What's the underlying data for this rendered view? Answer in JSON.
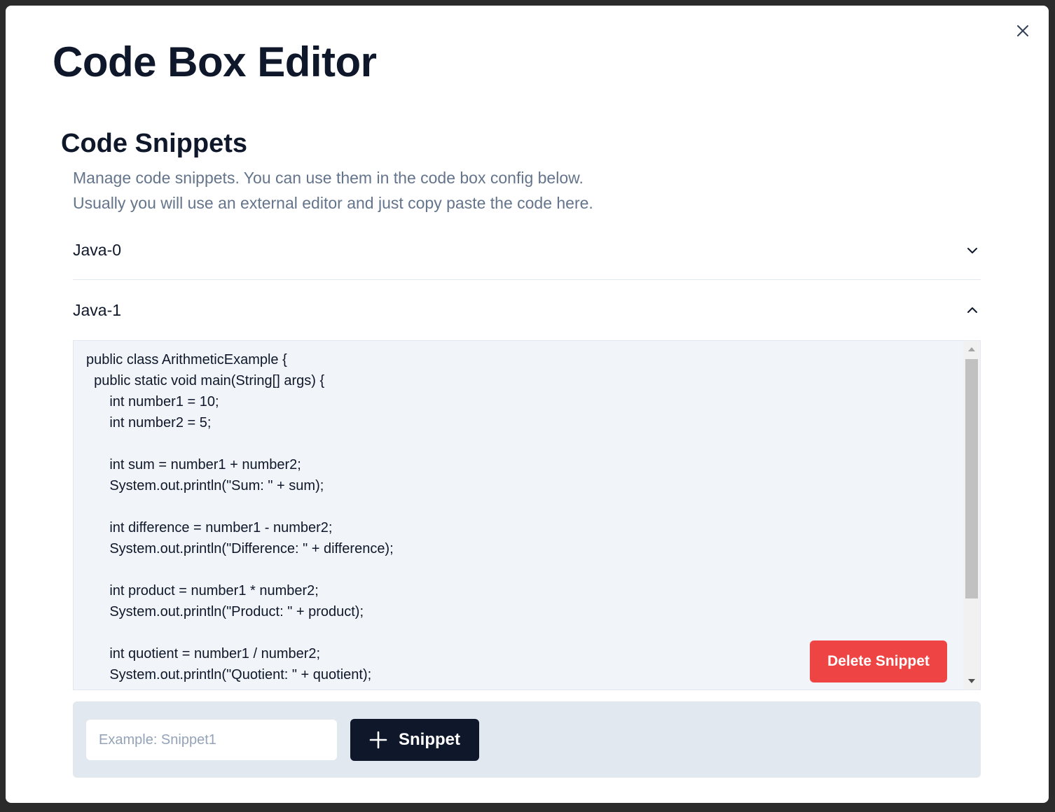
{
  "modal": {
    "title": "Code Box Editor",
    "close_icon": "close-icon"
  },
  "snippets_section": {
    "title": "Code Snippets",
    "description_line1": "Manage code snippets. You can use them in the code box config below.",
    "description_line2": "Usually you will use an external editor and just copy paste the code here."
  },
  "snippets": [
    {
      "label": "Java-0",
      "expanded": false,
      "chevron": "chevron-down-icon"
    },
    {
      "label": "Java-1",
      "expanded": true,
      "chevron": "chevron-up-icon",
      "code": "public class ArithmeticExample {\n  public static void main(String[] args) {\n      int number1 = 10;\n      int number2 = 5;\n\n      int sum = number1 + number2;\n      System.out.println(\"Sum: \" + sum);\n\n      int difference = number1 - number2;\n      System.out.println(\"Difference: \" + difference);\n\n      int product = number1 * number2;\n      System.out.println(\"Product: \" + product);\n\n      int quotient = number1 / number2;\n      System.out.println(\"Quotient: \" + quotient);",
      "delete_label": "Delete Snippet"
    }
  ],
  "add_snippet": {
    "input_value": "",
    "input_placeholder": "Example: Snippet1",
    "button_label": "Snippet",
    "button_icon": "plus-icon"
  },
  "colors": {
    "primary_dark": "#0f172a",
    "danger": "#ef4444",
    "muted_text": "#64748b",
    "code_bg": "#f1f5f9"
  }
}
